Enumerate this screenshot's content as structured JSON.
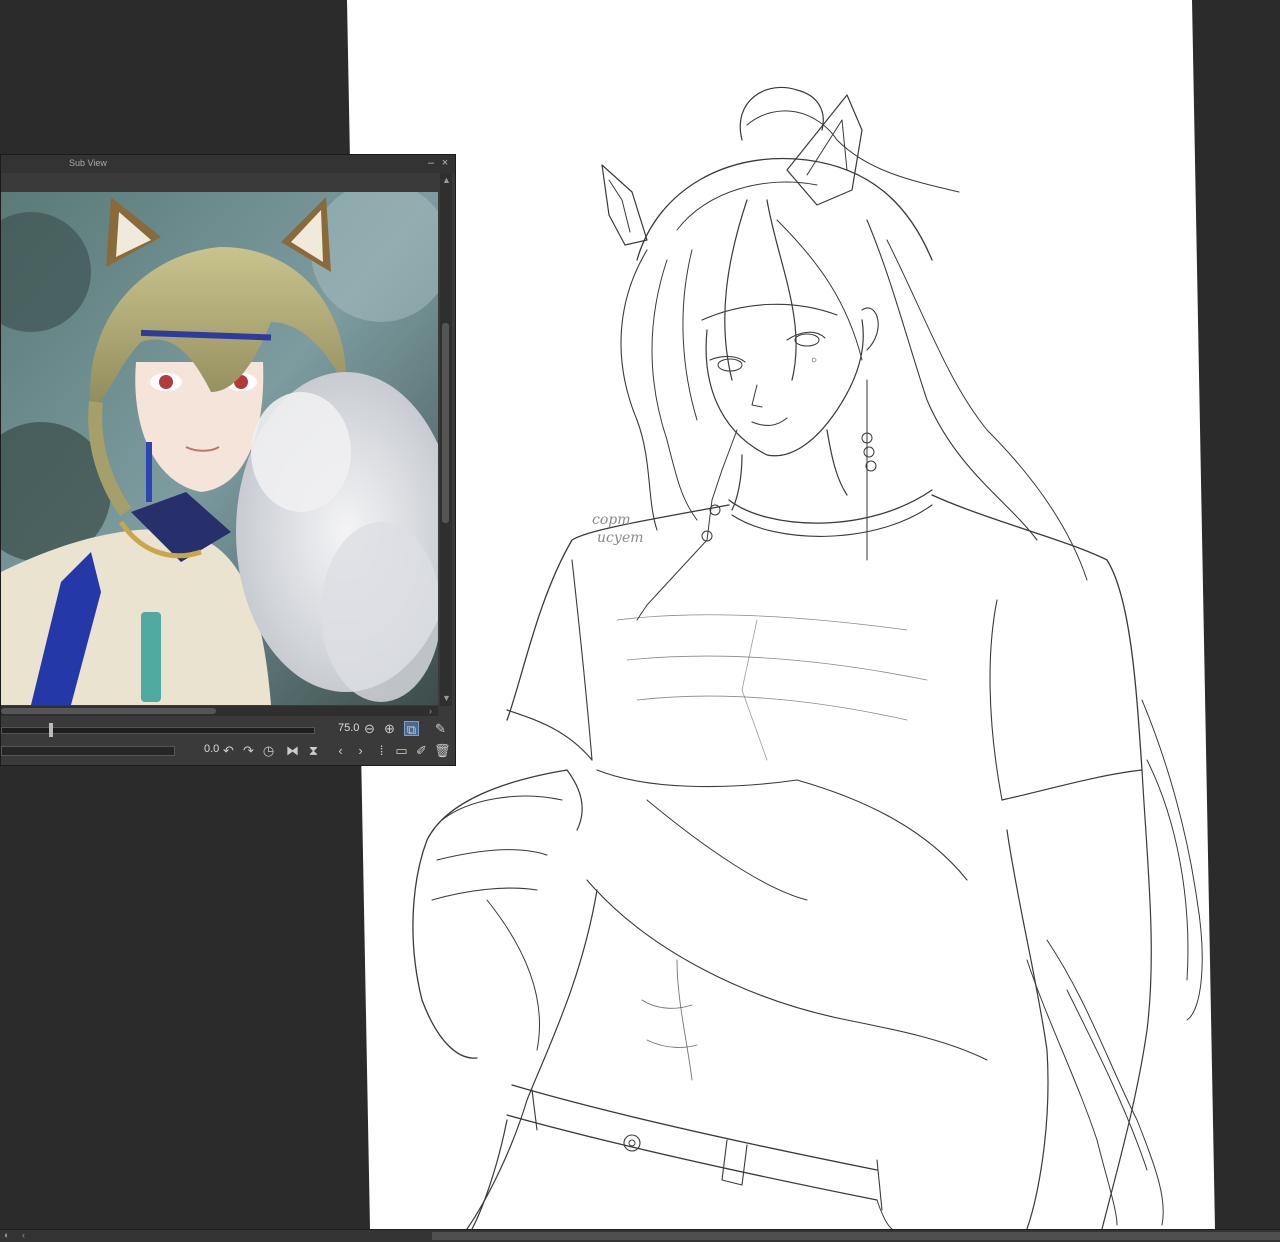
{
  "subview": {
    "title": "Sub View",
    "minimize_icon": "minimize-icon",
    "close_icon": "close-icon",
    "zoom_value": "75.0",
    "rotation_value": "0.0",
    "icons": [
      "zoom-out-icon",
      "zoom-in-icon",
      "fit-view-icon",
      "eyedropper-icon",
      "rotate-left-icon",
      "rotate-right-icon",
      "reset-rotation-icon",
      "flip-horizontal-icon",
      "flip-vertical-icon",
      "previous-icon",
      "next-icon",
      "thumbnail-grid-icon",
      "open-folder-icon",
      "edit-icon",
      "delete-icon"
    ],
    "zoom_level_fraction": 0.15,
    "reference_image": "anime-character-with-fox-ears-and-white-fur-reference"
  },
  "canvas": {
    "subject": "line-sketch-of-man-with-fox-ears-lifting-t-shirt",
    "watermark_line1": "сорт",
    "watermark_line2": "исует"
  },
  "colors": {
    "workspace": "#2b2b2b",
    "panel": "#3a3a3a",
    "paper": "#ffffff",
    "accent": "#4a6a8c"
  }
}
